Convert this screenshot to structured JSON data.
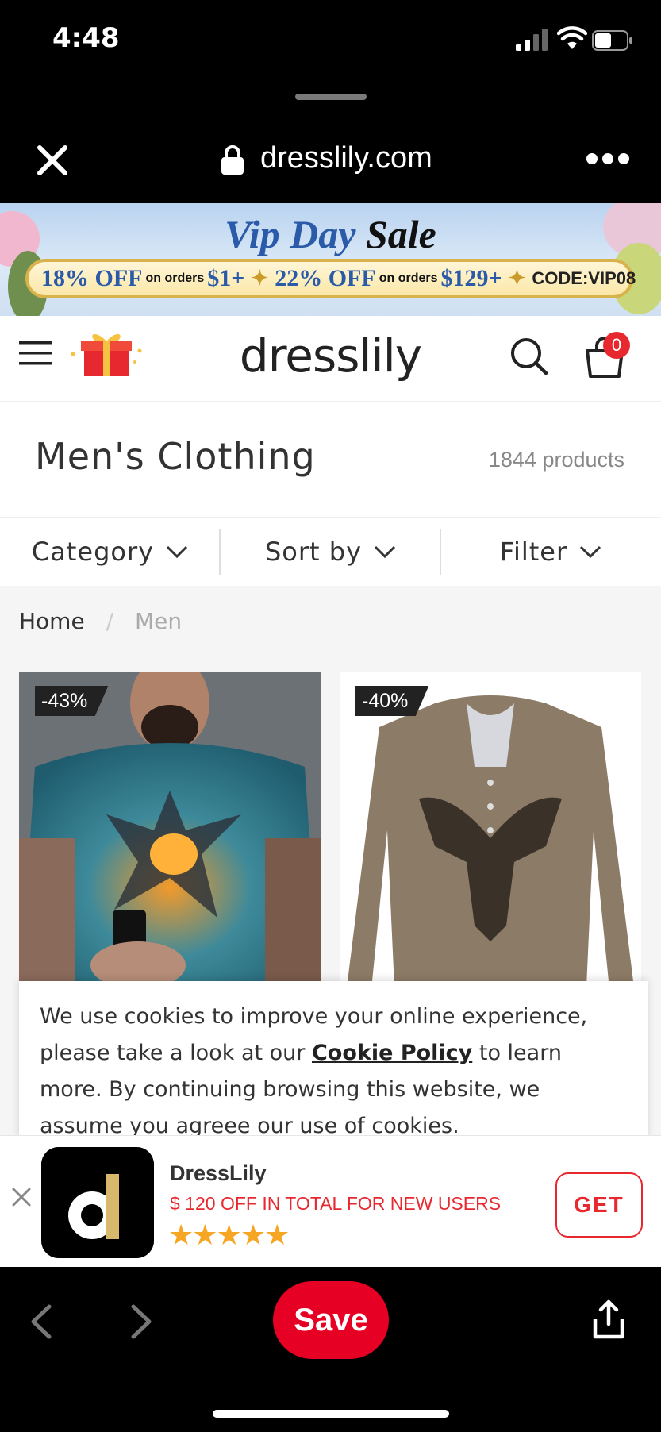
{
  "status_bar": {
    "time": "4:48"
  },
  "browser": {
    "url": "dresslily.com"
  },
  "banner": {
    "title_part1": "Vip Day",
    "title_part2": "Sale",
    "offer1_pct": "18% OFF",
    "offer1_cond": "on orders",
    "offer1_amount": "$1+",
    "offer2_pct": "22% OFF",
    "offer2_cond": "on orders",
    "offer2_amount": "$129+",
    "code": "CODE:VIP08"
  },
  "header": {
    "logo": "dresslily",
    "cart_count": "0"
  },
  "listing": {
    "title": "Men's Clothing",
    "count": "1844 products"
  },
  "filters": {
    "category": "Category",
    "sort": "Sort by",
    "filter": "Filter"
  },
  "breadcrumb": {
    "home": "Home",
    "separator": "/",
    "current": "Men"
  },
  "products": [
    {
      "discount": "-43%"
    },
    {
      "discount": "-40%"
    }
  ],
  "cookie": {
    "text_before": "We use cookies to improve your online experience, please take a look at our ",
    "link": "Cookie Policy",
    "text_after": " to learn more. By continuing browsing this website, we assume you agreee our use of cookies."
  },
  "app_banner": {
    "name": "DressLily",
    "promo": "$ 120 OFF IN TOTAL FOR NEW USERS",
    "stars": "★★★★★",
    "get_label": "GET",
    "icon_letter": "d"
  },
  "toolbar": {
    "save_label": "Save"
  },
  "colors": {
    "brand_red": "#e8282f",
    "save_red": "#e60023",
    "star_gold": "#f6a623"
  }
}
